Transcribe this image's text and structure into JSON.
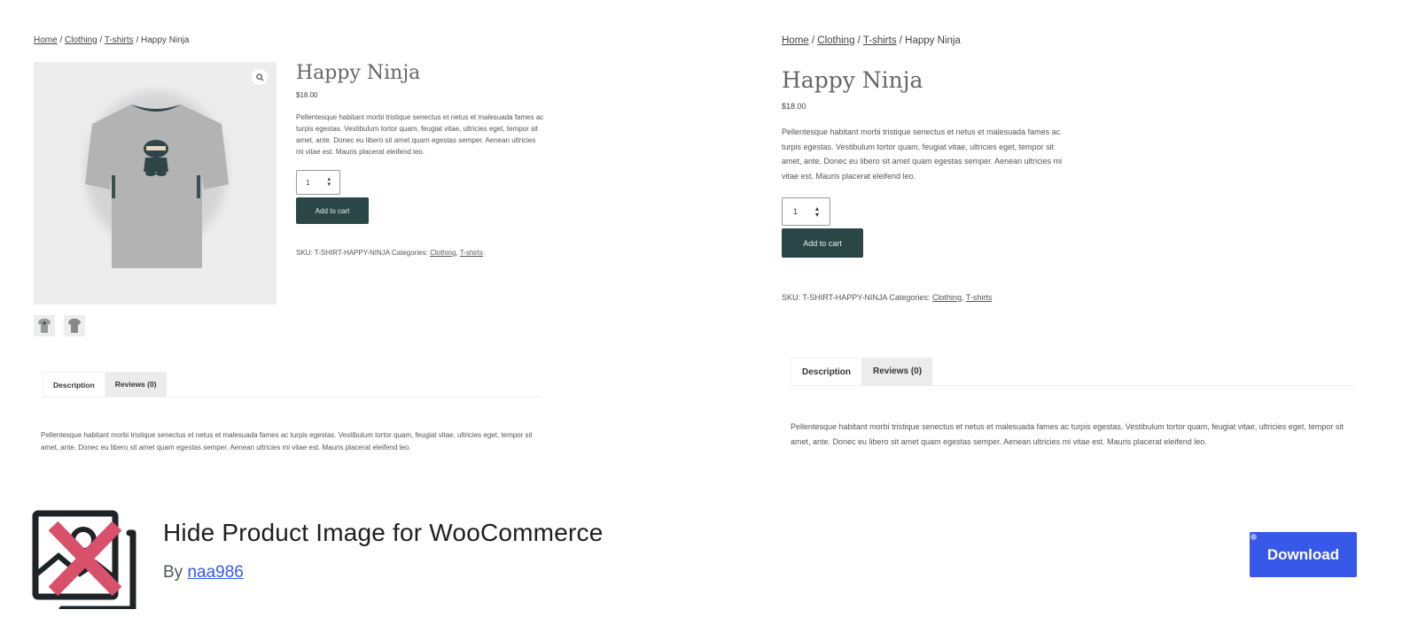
{
  "screenshots": {
    "left": {
      "breadcrumb": [
        {
          "label": "Home",
          "link": true
        },
        {
          "label": "Clothing",
          "link": true
        },
        {
          "label": "T-shirts",
          "link": true
        },
        {
          "label": "Happy Ninja",
          "link": false
        }
      ],
      "product": {
        "title": "Happy Ninja",
        "price": "$18.00",
        "short_description": "Pellentesque habitant morbi tristique senectus et netus et malesuada fames ac turpis egestas. Vestibulum tortor quam, feugiat vitae, ultricies eget, tempor sit amet, ante. Donec eu libero sit amet quam egestas semper. Aenean ultricies mi vitae est. Mauris placerat eleifend leo.",
        "quantity": "1",
        "add_to_cart_label": "Add to cart",
        "sku_label": "SKU:",
        "sku": "T-SHIRT-HAPPY-NINJA",
        "categories_label": "Categories:",
        "categories": [
          "Clothing",
          "T-shirts"
        ],
        "gallery_visible": true,
        "thumbnail_count": 2
      },
      "tabs": [
        {
          "label": "Description",
          "active": true
        },
        {
          "label": "Reviews (0)",
          "active": false
        }
      ],
      "description": "Pellentesque habitant morbi tristique senectus et netus et malesuada fames ac turpis egestas. Vestibulum tortor quam, feugiat vitae, ultricies eget, tempor sit amet, ante. Donec eu libero sit amet quam egestas semper. Aenean ultricies mi vitae est. Mauris placerat eleifend leo."
    },
    "right": {
      "breadcrumb": [
        {
          "label": "Home",
          "link": true
        },
        {
          "label": "Clothing",
          "link": true
        },
        {
          "label": "T-shirts",
          "link": true
        },
        {
          "label": "Happy Ninja",
          "link": false
        }
      ],
      "product": {
        "title": "Happy Ninja",
        "price": "$18.00",
        "short_description": "Pellentesque habitant morbi tristique senectus et netus et malesuada fames ac turpis egestas. Vestibulum tortor quam, feugiat vitae, ultricies eget, tempor sit amet, ante. Donec eu libero sit amet quam egestas semper. Aenean ultricies mi vitae est. Mauris placerat eleifend leo.",
        "quantity": "1",
        "add_to_cart_label": "Add to cart",
        "sku_label": "SKU:",
        "sku": "T-SHIRT-HAPPY-NINJA",
        "categories_label": "Categories:",
        "categories": [
          "Clothing",
          "T-shirts"
        ],
        "gallery_visible": false
      },
      "tabs": [
        {
          "label": "Description",
          "active": true
        },
        {
          "label": "Reviews (0)",
          "active": false
        }
      ],
      "description": "Pellentesque habitant morbi tristique senectus et netus et malesuada fames ac turpis egestas. Vestibulum tortor quam, feugiat vitae, ultricies eget, tempor sit amet, ante. Donec eu libero sit amet quam egestas semper. Aenean ultricies mi vitae est. Mauris placerat eleifend leo."
    }
  },
  "plugin": {
    "icon": "hidden-image-icon",
    "title": "Hide Product Image for WooCommerce",
    "by_label": "By",
    "author": "naa986",
    "download_label": "Download",
    "colors": {
      "accent": "#3858e9",
      "icon_cross": "#d9506a",
      "icon_frame": "#1d2327",
      "add_to_cart_bg": "#2b4647"
    }
  }
}
